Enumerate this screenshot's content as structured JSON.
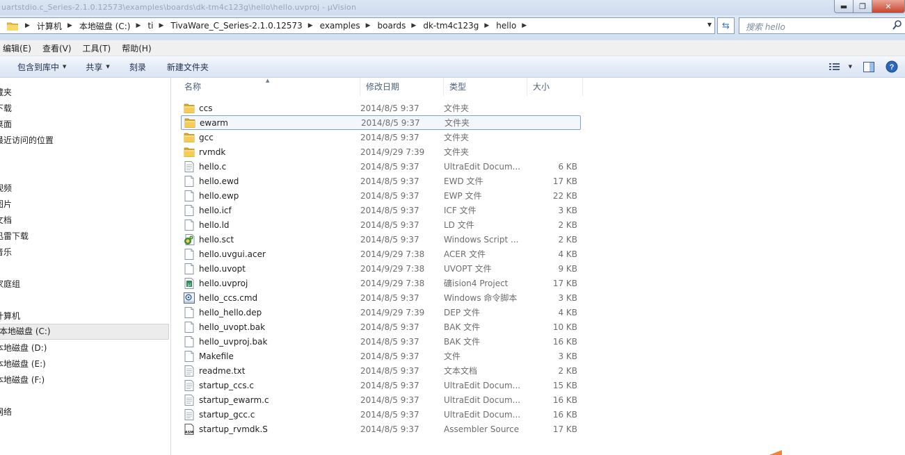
{
  "window": {
    "title": "uartstdio.c_Series-2.1.0.12573\\examples\\boards\\dk-tm4c123g\\hello\\hello.uvproj - µVision",
    "buttons": {
      "minimize": "▬",
      "maximize": "❐",
      "close": "✕"
    }
  },
  "address": {
    "crumbs": [
      "计算机",
      "本地磁盘 (C:)",
      "ti",
      "TivaWare_C_Series-2.1.0.12573",
      "examples",
      "boards",
      "dk-tm4c123g",
      "hello"
    ]
  },
  "search": {
    "placeholder": "搜索 hello"
  },
  "menu": [
    "编辑(E)",
    "查看(V)",
    "工具(T)",
    "帮助(H)"
  ],
  "toolbar": {
    "include_library": "包含到库中",
    "share": "共享",
    "burn": "刻录",
    "new_folder": "新建文件夹"
  },
  "sidebar": [
    {
      "label": "藏夹",
      "selected": false
    },
    {
      "label": "下载",
      "selected": false
    },
    {
      "label": "桌面",
      "selected": false
    },
    {
      "label": "最近访问的位置",
      "selected": false
    },
    {
      "label": "视频",
      "selected": false
    },
    {
      "label": "图片",
      "selected": false
    },
    {
      "label": "文档",
      "selected": false
    },
    {
      "label": "迅雷下载",
      "selected": false
    },
    {
      "label": "音乐",
      "selected": false
    },
    {
      "label": "家庭组",
      "selected": false
    },
    {
      "label": "计算机",
      "selected": false
    },
    {
      "label": "本地磁盘 (C:)",
      "selected": true
    },
    {
      "label": "本地磁盘 (D:)",
      "selected": false
    },
    {
      "label": "本地磁盘 (E:)",
      "selected": false
    },
    {
      "label": "本地磁盘 (F:)",
      "selected": false
    },
    {
      "label": "网络",
      "selected": false
    }
  ],
  "columns": {
    "name": "名称",
    "date": "修改日期",
    "type": "类型",
    "size": "大小"
  },
  "files": [
    {
      "name": "ccs",
      "date": "2014/8/5 9:37",
      "type": "文件夹",
      "size": "",
      "icon": "folder-icon"
    },
    {
      "name": "ewarm",
      "date": "2014/8/5 9:37",
      "type": "文件夹",
      "size": "",
      "icon": "folder-icon"
    },
    {
      "name": "gcc",
      "date": "2014/8/5 9:37",
      "type": "文件夹",
      "size": "",
      "icon": "folder-icon"
    },
    {
      "name": "rvmdk",
      "date": "2014/9/29 7:39",
      "type": "文件夹",
      "size": "",
      "icon": "folder-icon"
    },
    {
      "name": "hello.c",
      "date": "2014/8/5 9:37",
      "type": "UltraEdit Docum...",
      "size": "6 KB",
      "icon": "text-file-icon"
    },
    {
      "name": "hello.ewd",
      "date": "2014/8/5 9:37",
      "type": "EWD 文件",
      "size": "17 KB",
      "icon": "blank-file-icon"
    },
    {
      "name": "hello.ewp",
      "date": "2014/8/5 9:37",
      "type": "EWP 文件",
      "size": "22 KB",
      "icon": "blank-file-icon"
    },
    {
      "name": "hello.icf",
      "date": "2014/8/5 9:37",
      "type": "ICF 文件",
      "size": "3 KB",
      "icon": "blank-file-icon"
    },
    {
      "name": "hello.ld",
      "date": "2014/8/5 9:37",
      "type": "LD 文件",
      "size": "2 KB",
      "icon": "blank-file-icon"
    },
    {
      "name": "hello.sct",
      "date": "2014/8/5 9:37",
      "type": "Windows Script ...",
      "size": "2 KB",
      "icon": "script-file-icon"
    },
    {
      "name": "hello.uvgui.acer",
      "date": "2014/9/29 7:38",
      "type": "ACER 文件",
      "size": "4 KB",
      "icon": "blank-file-icon"
    },
    {
      "name": "hello.uvopt",
      "date": "2014/9/29 7:38",
      "type": "UVOPT 文件",
      "size": "9 KB",
      "icon": "blank-file-icon"
    },
    {
      "name": "hello.uvproj",
      "date": "2014/9/29 7:38",
      "type": "礦ision4 Project",
      "size": "17 KB",
      "icon": "uvision-project-icon"
    },
    {
      "name": "hello_ccs.cmd",
      "date": "2014/8/5 9:37",
      "type": "Windows 命令脚本",
      "size": "3 KB",
      "icon": "cmd-file-icon"
    },
    {
      "name": "hello_hello.dep",
      "date": "2014/9/29 7:39",
      "type": "DEP 文件",
      "size": "4 KB",
      "icon": "blank-file-icon"
    },
    {
      "name": "hello_uvopt.bak",
      "date": "2014/8/5 9:37",
      "type": "BAK 文件",
      "size": "10 KB",
      "icon": "blank-file-icon"
    },
    {
      "name": "hello_uvproj.bak",
      "date": "2014/8/5 9:37",
      "type": "BAK 文件",
      "size": "16 KB",
      "icon": "blank-file-icon"
    },
    {
      "name": "Makefile",
      "date": "2014/8/5 9:37",
      "type": "文件",
      "size": "3 KB",
      "icon": "blank-file-icon"
    },
    {
      "name": "readme.txt",
      "date": "2014/8/5 9:37",
      "type": "文本文档",
      "size": "2 KB",
      "icon": "text-file-icon"
    },
    {
      "name": "startup_ccs.c",
      "date": "2014/8/5 9:37",
      "type": "UltraEdit Docum...",
      "size": "15 KB",
      "icon": "text-file-icon"
    },
    {
      "name": "startup_ewarm.c",
      "date": "2014/8/5 9:37",
      "type": "UltraEdit Docum...",
      "size": "16 KB",
      "icon": "text-file-icon"
    },
    {
      "name": "startup_gcc.c",
      "date": "2014/8/5 9:37",
      "type": "UltraEdit Docum...",
      "size": "16 KB",
      "icon": "text-file-icon"
    },
    {
      "name": "startup_rvmdk.S",
      "date": "2014/8/5 9:37",
      "type": "Assembler Source",
      "size": "17 KB",
      "icon": "asm-file-icon"
    }
  ],
  "hover_index": 1
}
